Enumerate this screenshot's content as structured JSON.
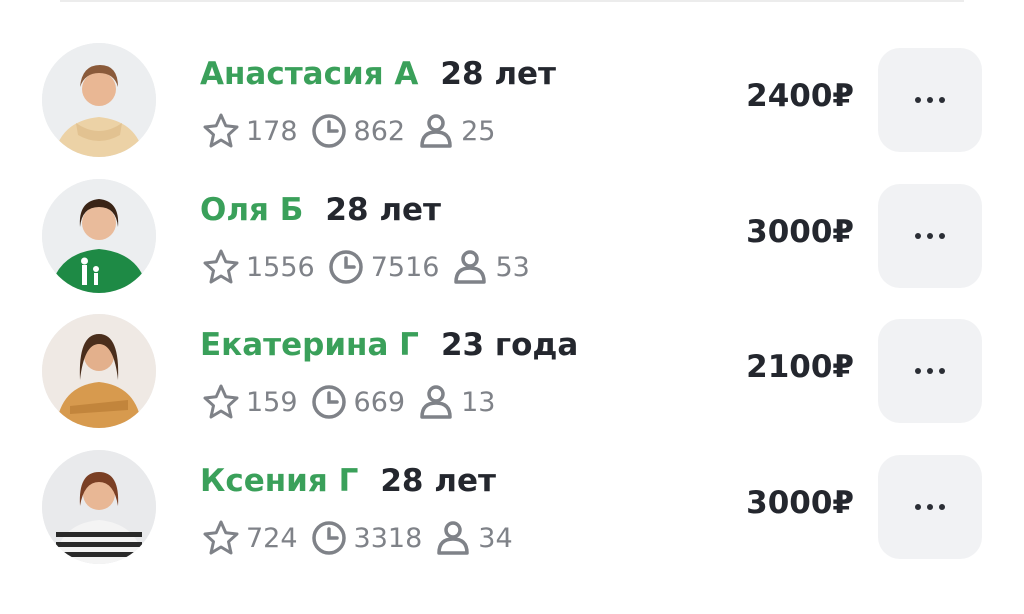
{
  "specialists": [
    {
      "name": "Анастасия А",
      "age": "28 лет",
      "rating": "178",
      "hours": "862",
      "clients": "25",
      "price": "2400₽"
    },
    {
      "name": "Оля Б",
      "age": "28 лет",
      "rating": "1556",
      "hours": "7516",
      "clients": "53",
      "price": "3000₽"
    },
    {
      "name": "Екатерина Г",
      "age": "23 года",
      "rating": "159",
      "hours": "669",
      "clients": "13",
      "price": "2100₽"
    },
    {
      "name": "Ксения Г",
      "age": "28 лет",
      "rating": "724",
      "hours": "3318",
      "clients": "34",
      "price": "3000₽"
    }
  ],
  "icons": {
    "rating": "star-icon",
    "hours": "clock-icon",
    "clients": "person-icon",
    "more": "more-dots-icon"
  },
  "colors": {
    "name": "#3aa05a",
    "text": "#24272e",
    "muted": "#7f8288",
    "button_bg": "#f1f2f4"
  }
}
